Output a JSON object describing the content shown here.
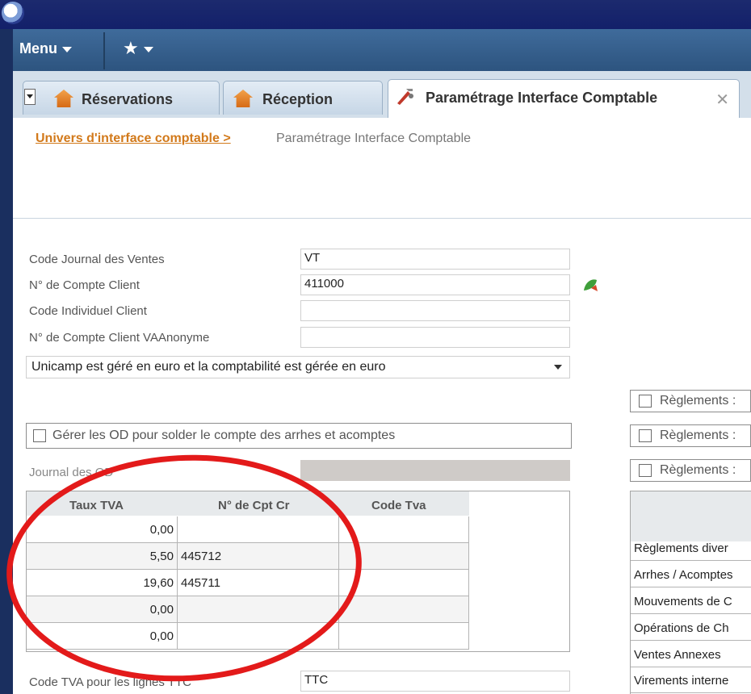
{
  "menu": {
    "menu_label": "Menu",
    "star_label": "★"
  },
  "tabs": [
    {
      "label": "Réservations"
    },
    {
      "label": "Réception"
    },
    {
      "label": "Paramétrage Interface Comptable",
      "close": "✕"
    }
  ],
  "breadcrumb": {
    "link": "Univers d'interface comptable >",
    "current": "Paramétrage Interface Comptable"
  },
  "form": {
    "code_journal_label": "Code Journal des Ventes",
    "code_journal_value": "VT",
    "compte_client_label": "N° de Compte Client",
    "compte_client_value": "411000",
    "code_individuel_label": "Code Individuel Client",
    "code_individuel_value": "",
    "compte_anonyme_label": "N° de Compte Client VAAnonyme",
    "compte_anonyme_value": "",
    "currency_select": "Unicamp est géré en euro et la comptabilité est gérée en euro",
    "od_checkbox_label": "Gérer les OD pour solder le compte des arrhes et acomptes",
    "journal_od_label": "Journal des OD",
    "code_tva_ttc_label": "Code TVA pour les lignes TTC",
    "code_tva_ttc_value": "TTC"
  },
  "reglements": [
    "Règlements :",
    "Règlements :",
    "Règlements :"
  ],
  "tva_grid": {
    "headers": [
      "Taux TVA",
      "N° de Cpt Cr",
      "Code Tva"
    ],
    "rows": [
      {
        "taux": "0,00",
        "compte": "",
        "code": ""
      },
      {
        "taux": "5,50",
        "compte": "445712",
        "code": ""
      },
      {
        "taux": "19,60",
        "compte": "445711",
        "code": ""
      },
      {
        "taux": "0,00",
        "compte": "",
        "code": ""
      },
      {
        "taux": "0,00",
        "compte": "",
        "code": ""
      }
    ]
  },
  "right_list": [
    "Règlements diver",
    "Arrhes / Acomptes",
    "Mouvements de C",
    "Opérations de Ch",
    "Ventes Annexes",
    "Virements interne"
  ],
  "colors": {
    "accent_orange": "#d2791a",
    "menu_blue": "#2d547f",
    "annotation_red": "#e31a1a"
  }
}
